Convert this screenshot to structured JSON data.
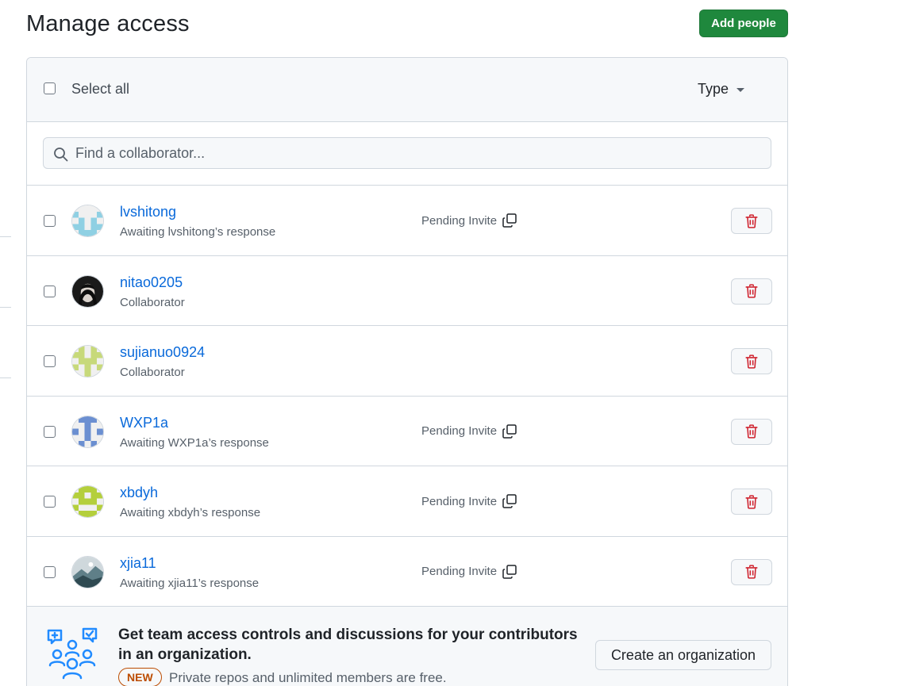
{
  "page": {
    "title": "Manage access",
    "add_button": "Add people"
  },
  "header": {
    "select_all": "Select all",
    "type_filter": "Type"
  },
  "search": {
    "placeholder": "Find a collaborator..."
  },
  "members": [
    {
      "name": "lvshitong",
      "subtitle": "Awaiting lvshitong’s response",
      "status": "Pending Invite",
      "avatar": "identicon-lightblue"
    },
    {
      "name": "nitao0205",
      "subtitle": "Collaborator",
      "status": "",
      "avatar": "photo-dark"
    },
    {
      "name": "sujianuo0924",
      "subtitle": "Collaborator",
      "status": "",
      "avatar": "identicon-yellowgreen"
    },
    {
      "name": "WXP1a",
      "subtitle": "Awaiting WXP1a’s response",
      "status": "Pending Invite",
      "avatar": "identicon-blue"
    },
    {
      "name": "xbdyh",
      "subtitle": "Awaiting xbdyh’s response",
      "status": "Pending Invite",
      "avatar": "identicon-lime"
    },
    {
      "name": "xjia11",
      "subtitle": "Awaiting xjia11’s response",
      "status": "Pending Invite",
      "avatar": "photo-landscape"
    }
  ],
  "promo": {
    "title": "Get team access controls and discussions for your contributors in an organization.",
    "badge": "NEW",
    "subtitle": "Private repos and unlimited members are free.",
    "button": "Create an organization"
  },
  "colors": {
    "primary_button": "#1f883d",
    "link": "#0969da",
    "danger": "#cf222e",
    "new_badge": "#bc4c00"
  },
  "icons": [
    "search-icon",
    "copy-icon",
    "trash-icon",
    "organization-icon",
    "caret-down-icon"
  ]
}
